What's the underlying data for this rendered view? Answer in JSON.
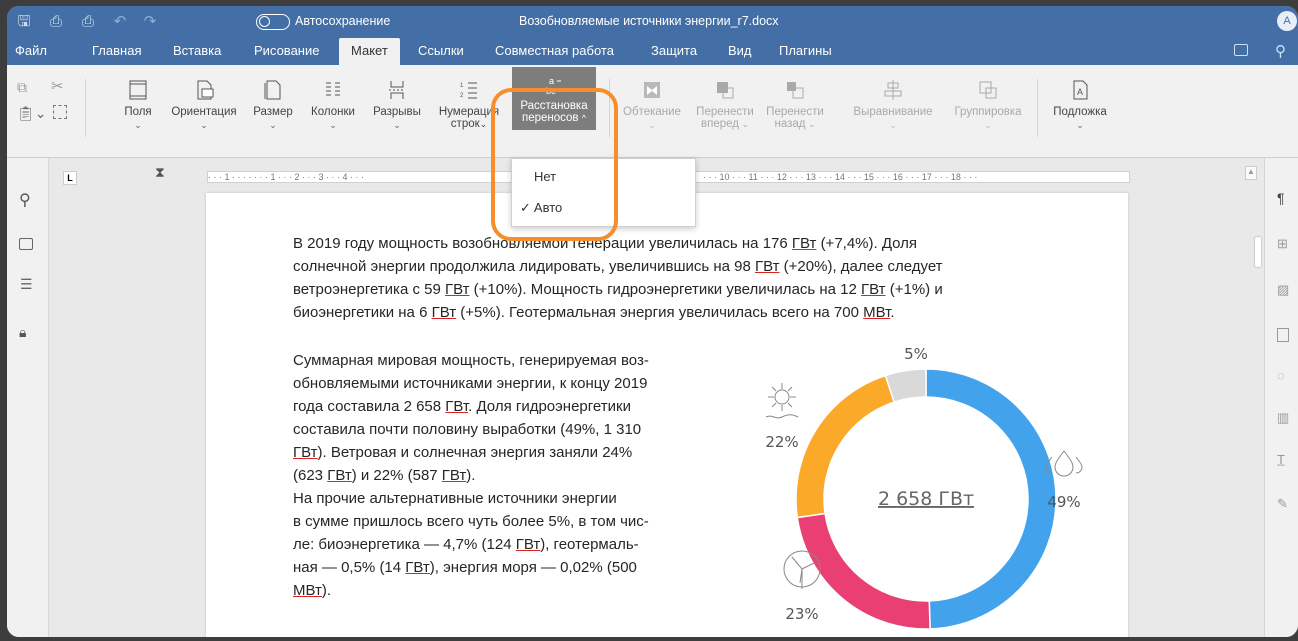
{
  "titlebar": {
    "autosave": "Автосохранение",
    "doc_title": "Возобновляемые источники энергии_r7.docx",
    "avatar": "A"
  },
  "menu": [
    "Файл",
    "Главная",
    "Вставка",
    "Рисование",
    "Макет",
    "Ссылки",
    "Совместная работа",
    "Защита",
    "Вид",
    "Плагины"
  ],
  "ribbon": {
    "margins": "Поля",
    "orientation": "Ориентация",
    "size": "Размер",
    "columns": "Колонки",
    "breaks": "Разрывы",
    "line_numbers_1": "Нумерация",
    "line_numbers_2": "строк",
    "hyphenation_1": "Расстановка",
    "hyphenation_2": "переносов",
    "wrap": "Обтекание",
    "forward_1": "Перенести",
    "forward_2": "вперед",
    "backward_1": "Перенести",
    "backward_2": "назад",
    "align": "Выравнивание",
    "group": "Группировка",
    "watermark": "Подложка"
  },
  "hyphen_menu": {
    "none": "Нет",
    "auto": "Авто",
    "check": "✓"
  },
  "ruler": "· · · 1 · · · ·  · · · 1 · · · 2 · · · 3 · · · 4 · · ·",
  "ruler2": "· · · 10 · · · 11 · · · 12 · · · 13 · · · 14 · · · 15 · · · 16 · · · 17 · · · 18 · · ·",
  "doc": {
    "p1_l1": "В 2019 году мощность возобновляемой генерации увеличилась на 176 ",
    "p1_l1b": "(+7,4%). Доля",
    "p1_l2": "солнечной энергии продолжила лидировать, увеличившись на 98 ",
    "p1_l2b": "(+20%), далее следует",
    "p1_l3": "ветроэнергетика с 59 ",
    "p1_l3b": "(+10%). Мощность гидроэнергетики увеличилась на 12 ",
    "p1_l3c": "(+1%) и",
    "p1_l4": "биоэнергетики на 6 ",
    "p1_l4b": "(+5%). Геотермальная энергия увеличилась всего на 700 ",
    "gw": "ГВт",
    "mw": "МВт",
    "p2": [
      "Суммарная мировая мощность, генерируемая воз-",
      "обновляемыми источниками энергии, к концу 2019",
      "года составила 2 658 ГВт.  Доля гидроэнергетики",
      "составила почти половину выработки (49%, 1 310",
      "ГВт). Ветровая и солнечная энергия заняли 24%",
      "(623 ГВт) и 22% (587 ГВт).",
      "На прочие альтернативные источники энергии",
      "в сумме пришлось всего чуть более 5%, в том чис-",
      "ле: биоэнергетика — 4,7% (124 ГВт), геотермаль-",
      "ная — 0,5% (14 ГВт), энергия моря — 0,02% (500",
      "МВт)."
    ]
  },
  "chart_data": {
    "type": "pie",
    "center_label": "2 658 ГВт",
    "categories": [
      "Гидроэнергетика",
      "Ветер",
      "Солнце",
      "Прочие"
    ],
    "values": [
      49,
      23,
      22,
      5
    ],
    "labels": [
      "49%",
      "23%",
      "22%",
      "5%"
    ],
    "colors": [
      "#42a3ec",
      "#ea3f73",
      "#fba928",
      "#d9d9d9"
    ]
  }
}
